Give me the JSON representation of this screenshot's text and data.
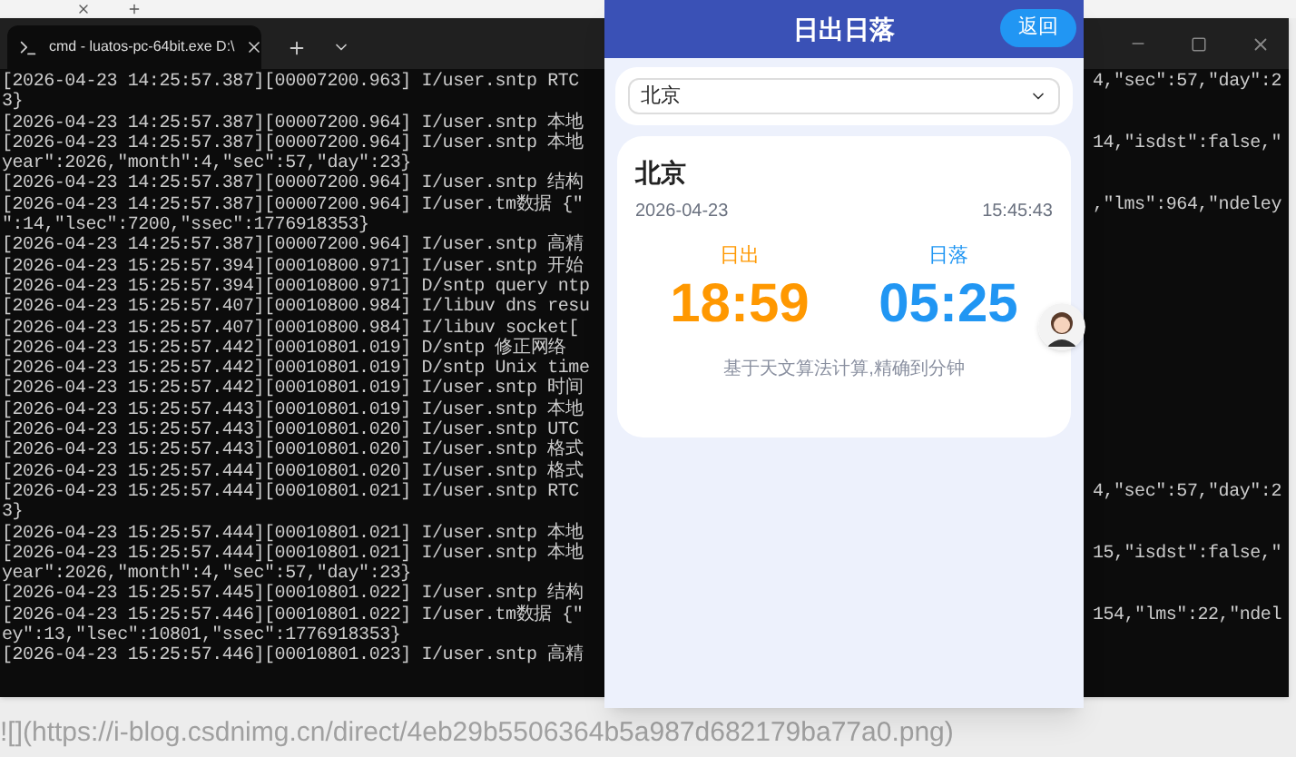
{
  "terminal": {
    "tab_title": "cmd - luatos-pc-64bit.exe D:\\",
    "lines": [
      {
        "left": "[2026-04-23 14:25:57.387][00007200.963] I/user.sntp RTC",
        "right": "4,\"sec\":57,\"day\":2"
      },
      {
        "left": "3}"
      },
      {
        "left": "[2026-04-23 14:25:57.387][00007200.964] I/user.sntp 本地"
      },
      {
        "left": "[2026-04-23 14:25:57.387][00007200.964] I/user.sntp 本地",
        "right": "14,\"isdst\":false,\""
      },
      {
        "left": "year\":2026,\"month\":4,\"sec\":57,\"day\":23}"
      },
      {
        "left": "[2026-04-23 14:25:57.387][00007200.964] I/user.sntp 结构"
      },
      {
        "left": "[2026-04-23 14:25:57.387][00007200.964] I/user.tm数据 {\"",
        "right": ",\"lms\":964,\"ndeley"
      },
      {
        "left": "\":14,\"lsec\":7200,\"ssec\":1776918353}"
      },
      {
        "left": "[2026-04-23 14:25:57.387][00007200.964] I/user.sntp 高精"
      },
      {
        "left": "[2026-04-23 15:25:57.394][00010800.971] I/user.sntp 开始"
      },
      {
        "left": "[2026-04-23 15:25:57.394][00010800.971] D/sntp query ntp"
      },
      {
        "left": "[2026-04-23 15:25:57.407][00010800.984] I/libuv dns resu"
      },
      {
        "left": "[2026-04-23 15:25:57.407][00010800.984] I/libuv socket["
      },
      {
        "left": "[2026-04-23 15:25:57.442][00010801.019] D/sntp 修正网络"
      },
      {
        "left": "[2026-04-23 15:25:57.442][00010801.019] D/sntp Unix time"
      },
      {
        "left": "[2026-04-23 15:25:57.442][00010801.019] I/user.sntp 时间"
      },
      {
        "left": "[2026-04-23 15:25:57.443][00010801.019] I/user.sntp 本地"
      },
      {
        "left": "[2026-04-23 15:25:57.443][00010801.020] I/user.sntp UTC"
      },
      {
        "left": "[2026-04-23 15:25:57.443][00010801.020] I/user.sntp 格式"
      },
      {
        "left": "[2026-04-23 15:25:57.444][00010801.020] I/user.sntp 格式"
      },
      {
        "left": "[2026-04-23 15:25:57.444][00010801.021] I/user.sntp RTC",
        "right": "4,\"sec\":57,\"day\":2"
      },
      {
        "left": "3}"
      },
      {
        "left": "[2026-04-23 15:25:57.444][00010801.021] I/user.sntp 本地"
      },
      {
        "left": "[2026-04-23 15:25:57.444][00010801.021] I/user.sntp 本地",
        "right": "15,\"isdst\":false,\""
      },
      {
        "left": "year\":2026,\"month\":4,\"sec\":57,\"day\":23}"
      },
      {
        "left": "[2026-04-23 15:25:57.445][00010801.022] I/user.sntp 结构"
      },
      {
        "left": "[2026-04-23 15:25:57.446][00010801.022] I/user.tm数据 {\"",
        "right": "154,\"lms\":22,\"ndel"
      },
      {
        "left": "ey\":13,\"lsec\":10801,\"ssec\":1776918353}"
      },
      {
        "left": "[2026-04-23 15:25:57.446][00010801.023] I/user.sntp 高精"
      }
    ]
  },
  "app": {
    "title": "日出日落",
    "back_button": "返回",
    "city_select": {
      "value": "北京"
    },
    "card": {
      "city": "北京",
      "date": "2026-04-23",
      "time": "15:45:43",
      "sunrise": {
        "label": "日出",
        "time": "18:59"
      },
      "sunset": {
        "label": "日落",
        "time": "05:25"
      },
      "note": "基于天文算法计算,精确到分钟"
    }
  },
  "footer_text": "![](https://i-blog.csdnimg.cn/direct/4eb29b5506364b5a987d682179ba77a0.png)"
}
